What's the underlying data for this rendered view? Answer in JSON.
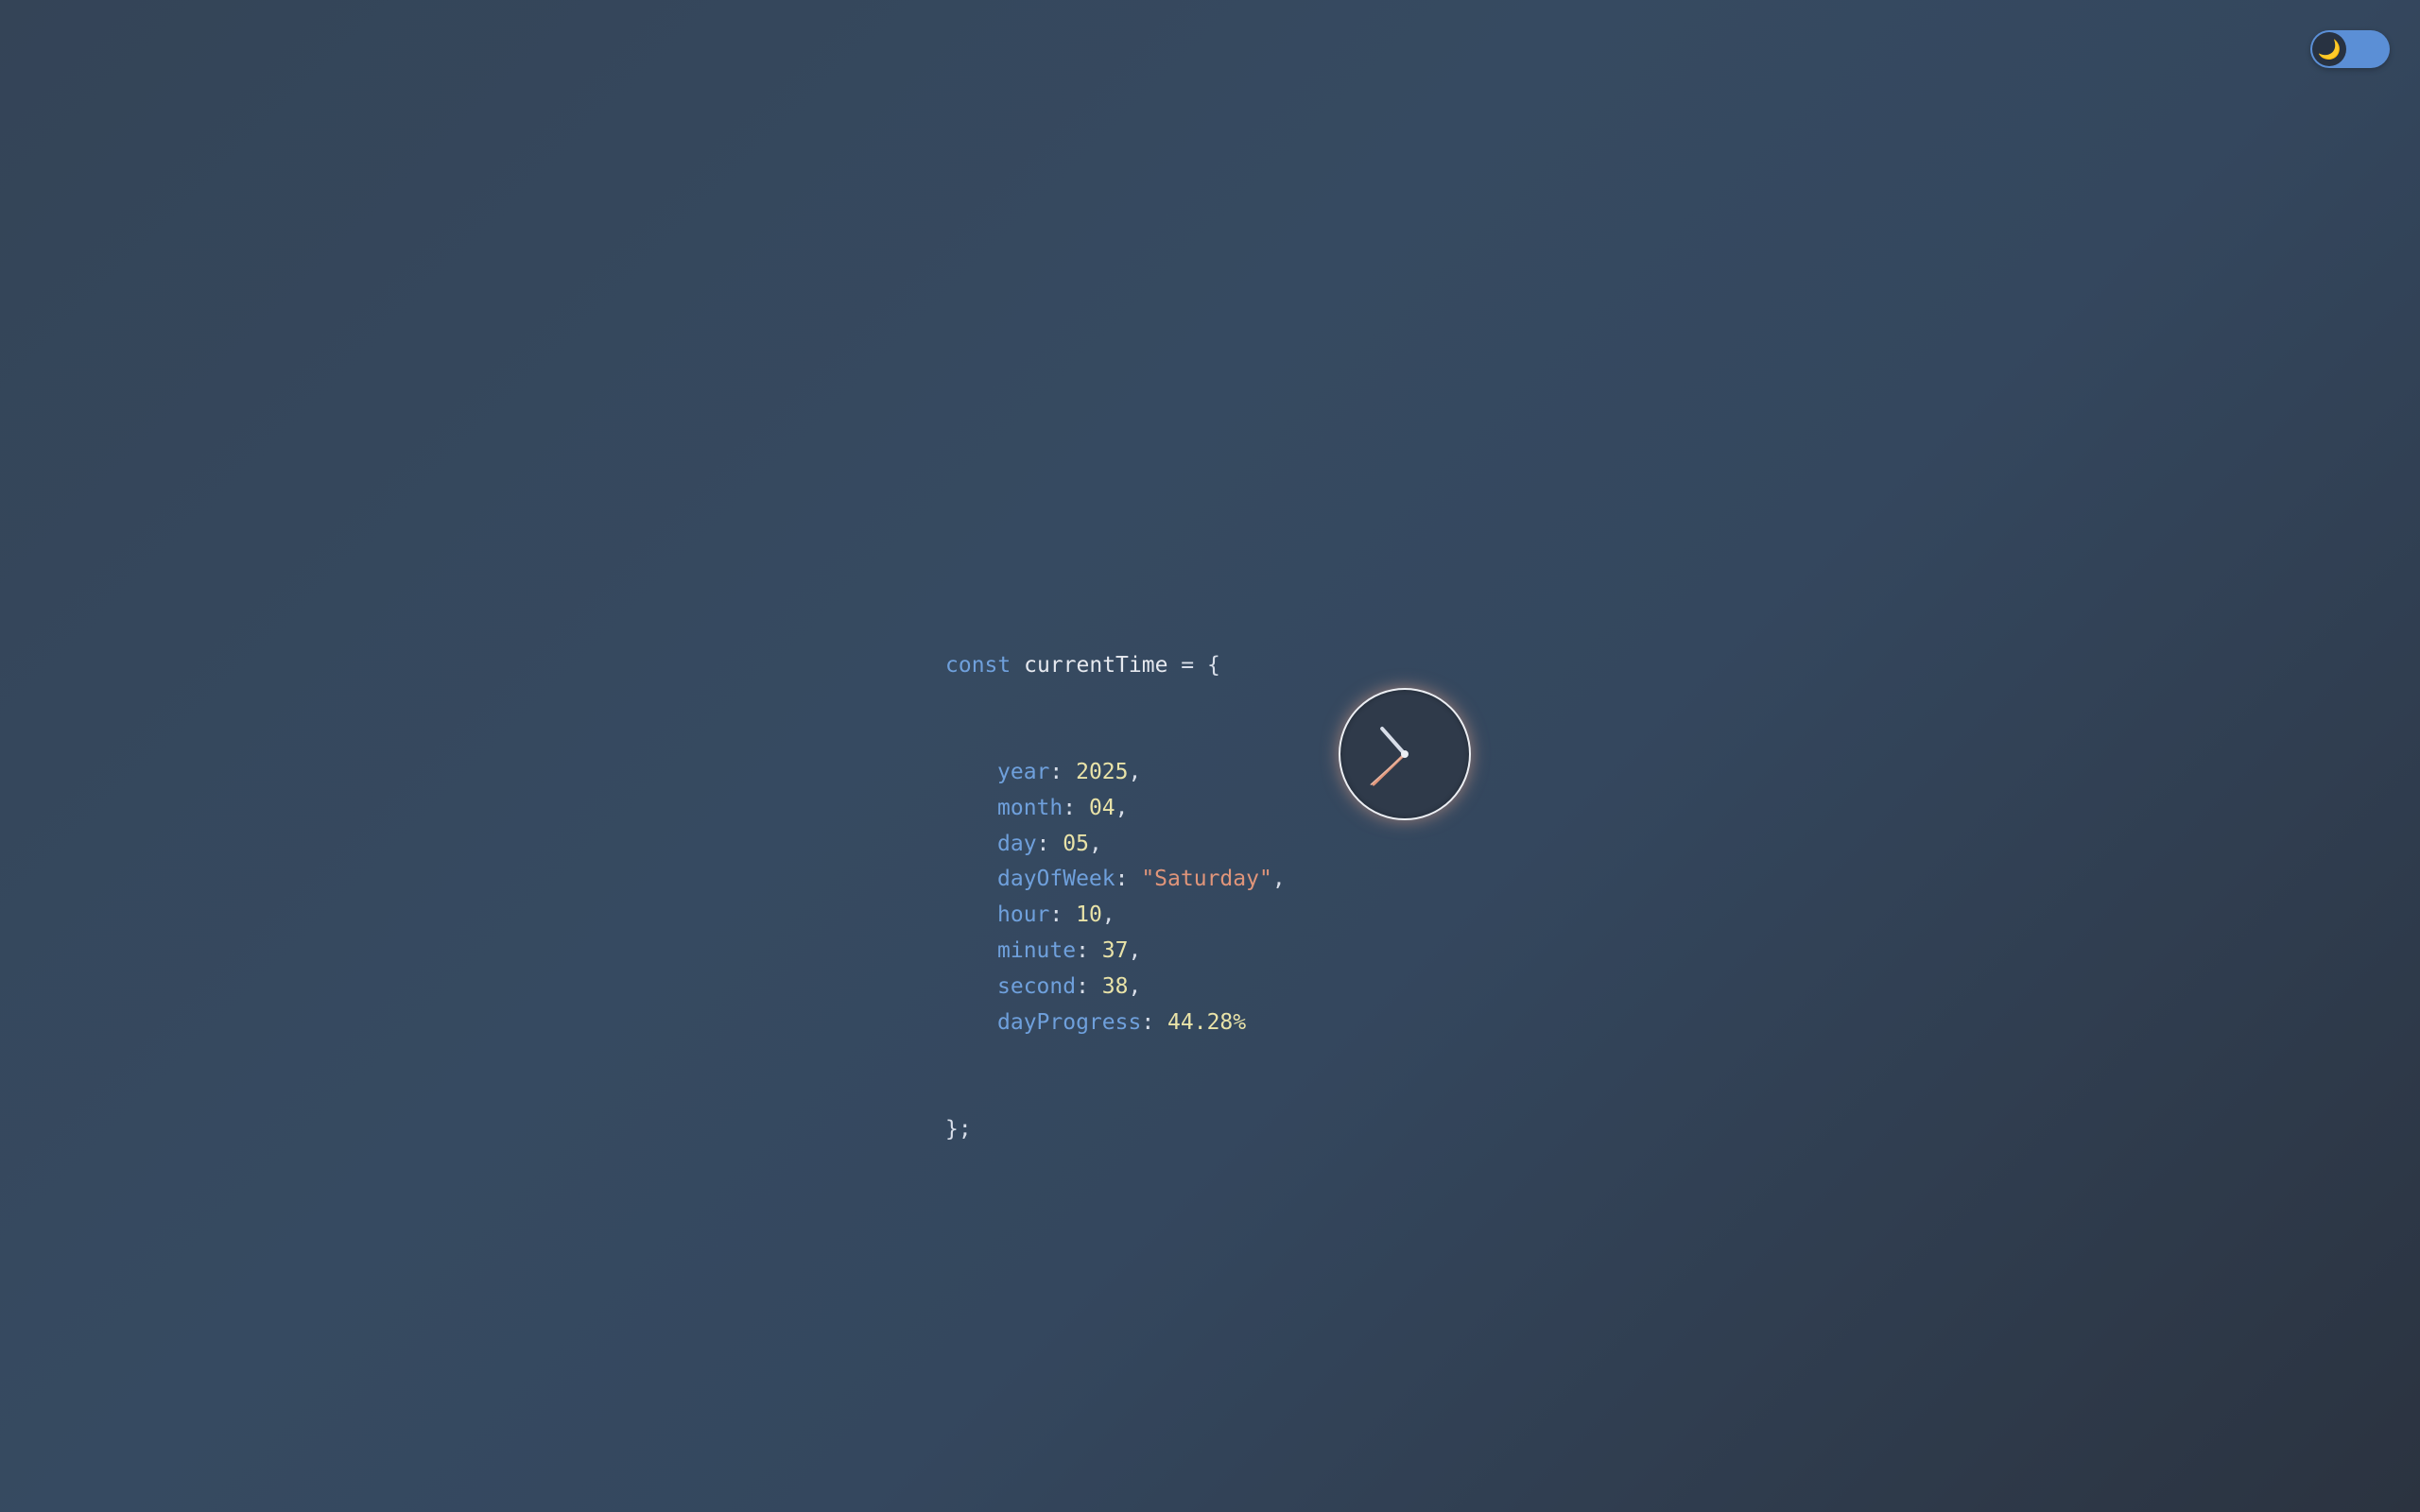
{
  "theme_toggle": {
    "icon": "moon-icon",
    "glyph": "🌙",
    "state": "dark"
  },
  "code": {
    "keyword": "const",
    "variable": "currentTime",
    "assign": " = {",
    "closing": "};",
    "fields": [
      {
        "key": "year",
        "value": "2025",
        "type": "number",
        "suffix": ","
      },
      {
        "key": "month",
        "value": "04",
        "type": "number",
        "suffix": ","
      },
      {
        "key": "day",
        "value": "05",
        "type": "number",
        "suffix": ","
      },
      {
        "key": "dayOfWeek",
        "value": "\"Saturday\"",
        "type": "string",
        "suffix": ","
      },
      {
        "key": "hour",
        "value": "10",
        "type": "number",
        "suffix": ","
      },
      {
        "key": "minute",
        "value": "37",
        "type": "number",
        "suffix": ","
      },
      {
        "key": "second",
        "value": "38",
        "type": "number",
        "suffix": ","
      },
      {
        "key": "dayProgress",
        "value": "44.28%",
        "type": "number",
        "suffix": ""
      }
    ]
  },
  "clock": {
    "hour": 10,
    "minute": 37,
    "second": 38,
    "colors": {
      "hand": "#d8dee9",
      "second_hand": "#e0957a",
      "face_border": "#eceff4"
    }
  }
}
